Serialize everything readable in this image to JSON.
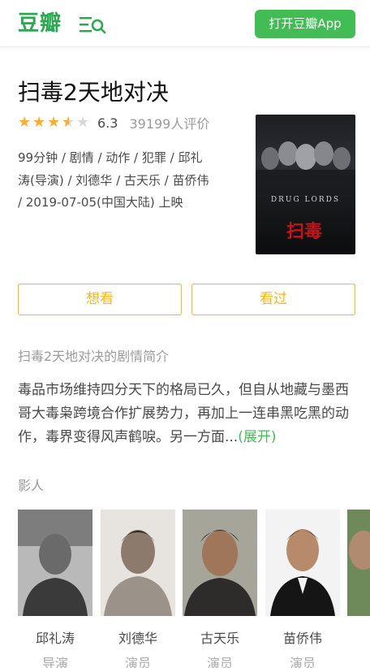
{
  "header": {
    "logo": "豆瓣",
    "open_app": "打开豆瓣App",
    "menu_search_icon": "menu-search-icon"
  },
  "movie": {
    "title": "扫毒2天地对决",
    "rating": {
      "stars": 3.5,
      "stars_out_of": 5,
      "score": "6.3",
      "votes": "39199人评价",
      "star_color": "#ffac2d"
    },
    "meta_lines": [
      "99分钟 / 剧情 / 动作 / 犯罪 / 邱礼",
      "涛(导演) / 刘德华 / 古天乐 / 苗侨伟",
      "/ 2019-07-05(中国大陆) 上映"
    ],
    "poster": {
      "english_title": "DRUG LORDS",
      "red_title": "扫毒"
    }
  },
  "actions": {
    "want": "想看",
    "seen": "看过"
  },
  "intro": {
    "heading": "扫毒2天地对决的剧情简介",
    "text": "毒品市场维持四分天下的格局已久，但自从地藏与墨西哥大毒枭跨境合作扩展势力，再加上一连串黑吃黑的动作，毒界变得风声鹤唳。另一方面...",
    "expand": "(展开)"
  },
  "cast": {
    "heading": "影人",
    "members": [
      {
        "name": "邱礼涛",
        "role": "导演"
      },
      {
        "name": "刘德华",
        "role": "演员"
      },
      {
        "name": "古天乐",
        "role": "演员"
      },
      {
        "name": "苗侨伟",
        "role": "演员"
      }
    ]
  },
  "colors": {
    "brand_green": "#42bd56",
    "logo_green": "#2aa84f",
    "want_yellow": "#ffb712"
  }
}
